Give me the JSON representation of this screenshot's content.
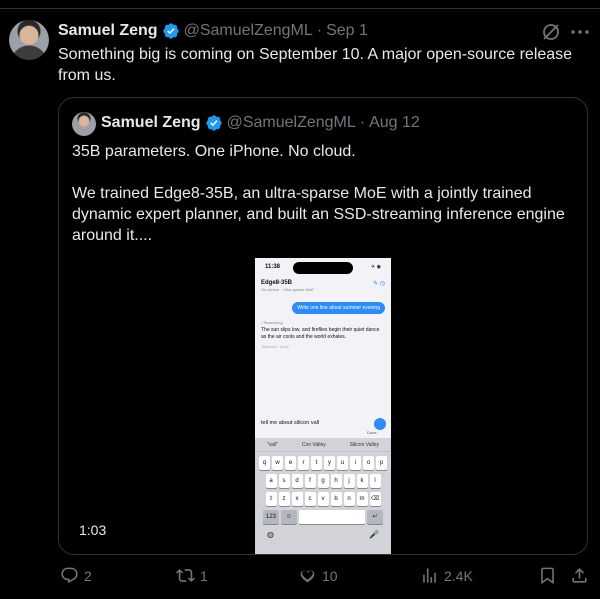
{
  "post": {
    "author_name": "Samuel Zeng",
    "handle": "@SamuelZengML",
    "separator": "·",
    "date": "Sep 1",
    "text": "Something big is coming on September 10. A major open-source release from us."
  },
  "quoted": {
    "author_name": "Samuel Zeng",
    "handle": "@SamuelZengML",
    "separator": "·",
    "date": "Aug 12",
    "paragraph1": "35B parameters. One iPhone. No cloud.",
    "paragraph2": "We trained Edge8-35B, an ultra-sparse MoE with a jointly trained dynamic expert planner, and built an SSD-streaming inference engine around it....",
    "video": {
      "duration": "1:03",
      "phone": {
        "time": "11:38",
        "status_icons": "✈ ◉",
        "title": "Edge8-35B",
        "subtitle": "On-device · Ultra-sparse MoE",
        "header_icons": "✎ ◷",
        "user_message": "Write one line about summer evening",
        "reasoning_label": "› Reasoning",
        "answer": "The sun slips low, and fireflies begin their quiet dance as the air cools and the world exhales.",
        "answer_meta": "Tokens/s · local",
        "input_text": "tell me about silicon vall",
        "done_label": "Done",
        "suggestions": [
          "\"vall\"",
          "Con Valley",
          "Silicon Valley"
        ],
        "keys_row1": [
          "q",
          "w",
          "e",
          "r",
          "t",
          "y",
          "u",
          "i",
          "o",
          "p"
        ],
        "keys_row2": [
          "a",
          "s",
          "d",
          "f",
          "g",
          "h",
          "j",
          "k",
          "l"
        ],
        "keys_row3": [
          "⇧",
          "z",
          "x",
          "c",
          "v",
          "b",
          "n",
          "m",
          "⌫"
        ],
        "key_numbers": "123",
        "key_emoji": "☺",
        "key_return": "↵",
        "globe": "◍",
        "mic": "🎤"
      }
    }
  },
  "actions": {
    "replies": "2",
    "reposts": "1",
    "likes": "10",
    "views": "2.4K"
  },
  "colors": {
    "background": "#000000",
    "text": "#e7e9ea",
    "muted": "#71767b",
    "verified": "#1d9bf0",
    "border": "#2f3336"
  }
}
